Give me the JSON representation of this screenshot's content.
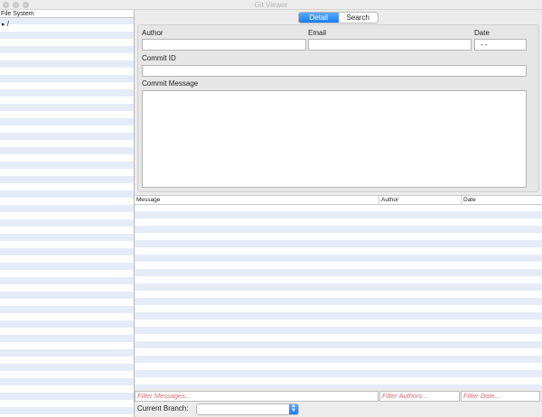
{
  "window": {
    "title": "Git Viewer"
  },
  "file_system": {
    "header": "File System",
    "root": "/"
  },
  "tabs": [
    {
      "label": "Detail",
      "active": true
    },
    {
      "label": "Search",
      "active": false
    }
  ],
  "detail": {
    "author_label": "Author",
    "author_value": "",
    "email_label": "Email",
    "email_value": "",
    "date_label": "Date",
    "date_value": "-  -",
    "commit_id_label": "Commit ID",
    "commit_id_value": "",
    "commit_message_label": "Commit Message",
    "commit_message_value": ""
  },
  "commit_table": {
    "columns": [
      "Message",
      "Author",
      "Date"
    ],
    "rows": []
  },
  "filters": {
    "messages_placeholder": "Filter Messages...",
    "authors_placeholder": "Filter Authors...",
    "date_placeholder": "Filter Date..."
  },
  "branch": {
    "label": "Current Branch:",
    "value": ""
  },
  "colors": {
    "accent": "#1a7ef5",
    "placeholder": "#e06a6a",
    "stripe": "#e5ecf8"
  }
}
